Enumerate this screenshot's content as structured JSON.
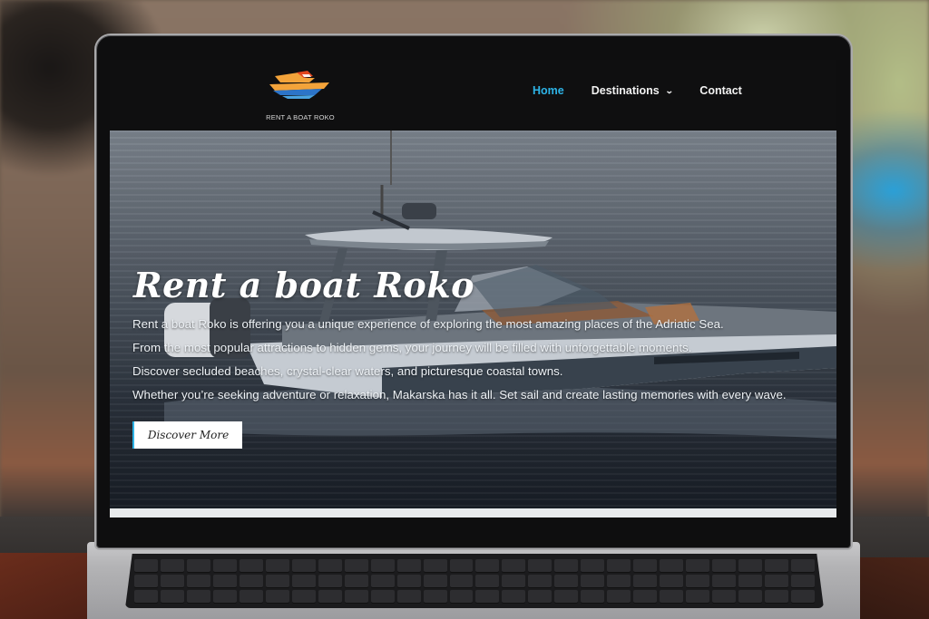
{
  "brand": {
    "name": "RENT A BOAT ROKO",
    "logo_icon": "speedboat-logo-icon",
    "logo_colors": [
      "#f3a33a",
      "#e2461f",
      "#2c74c8",
      "#4aa3e0"
    ]
  },
  "nav": {
    "items": [
      {
        "label": "Home",
        "active": true
      },
      {
        "label": "Destinations",
        "has_dropdown": true
      },
      {
        "label": "Contact"
      }
    ],
    "active_color": "#2db3e6"
  },
  "hero": {
    "title": "Rent a boat Roko",
    "lines": [
      "Rent a boat Roko is offering you a unique experience of exploring the most amazing places of the Adriatic Sea.",
      "From the most popular attractions to hidden gems, your journey will be filled with unforgettable moments.",
      "Discover secluded beaches, crystal-clear waters, and picturesque coastal towns.",
      "Whether you’re seeking adventure or relaxation, Makarska has it all. Set sail and create lasting memories with every wave."
    ],
    "cta_label": "Discover More",
    "background_image": "speedboat-on-sea-photo"
  }
}
